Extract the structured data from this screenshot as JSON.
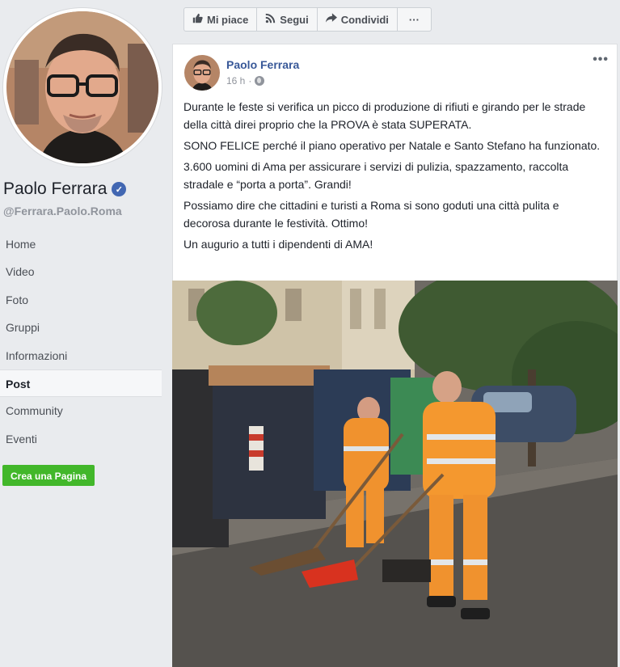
{
  "profile": {
    "name": "Paolo Ferrara",
    "handle": "@Ferrara.Paolo.Roma",
    "verified_icon": "verified-badge-icon"
  },
  "sidebar": {
    "items": [
      {
        "label": "Home",
        "active": false
      },
      {
        "label": "Video",
        "active": false
      },
      {
        "label": "Foto",
        "active": false
      },
      {
        "label": "Gruppi",
        "active": false
      },
      {
        "label": "Informazioni",
        "active": false
      },
      {
        "label": "Post",
        "active": true
      },
      {
        "label": "Community",
        "active": false
      },
      {
        "label": "Eventi",
        "active": false
      }
    ],
    "create_page_label": "Crea una Pagina"
  },
  "action_bar": {
    "like_label": "Mi piace",
    "follow_label": "Segui",
    "share_label": "Condividi",
    "more_label": "···"
  },
  "post": {
    "author": "Paolo Ferrara",
    "time": "16 h",
    "separator": "·",
    "more_label": "•••",
    "paragraphs": [
      "Durante le feste si verifica un picco di produzione di rifiuti e girando per le strade della città direi proprio che la PROVA è stata SUPERATA.",
      "SONO FELICE perché il piano operativo per Natale e Santo Stefano ha funzionato.",
      "3.600 uomini di Ama per assicurare i servizi di pulizia, spazzamento, raccolta stradale e “porta a porta”. Grandi!",
      "Possiamo dire che cittadini e turisti a Roma si sono goduti una città pulita e decorosa durante le festività. Ottimo!",
      "Un augurio a tutti i dipendenti di AMA!"
    ]
  },
  "colors": {
    "link": "#385898",
    "brand": "#4267b2",
    "create_button": "#42b72a",
    "background": "#e9ebee"
  }
}
